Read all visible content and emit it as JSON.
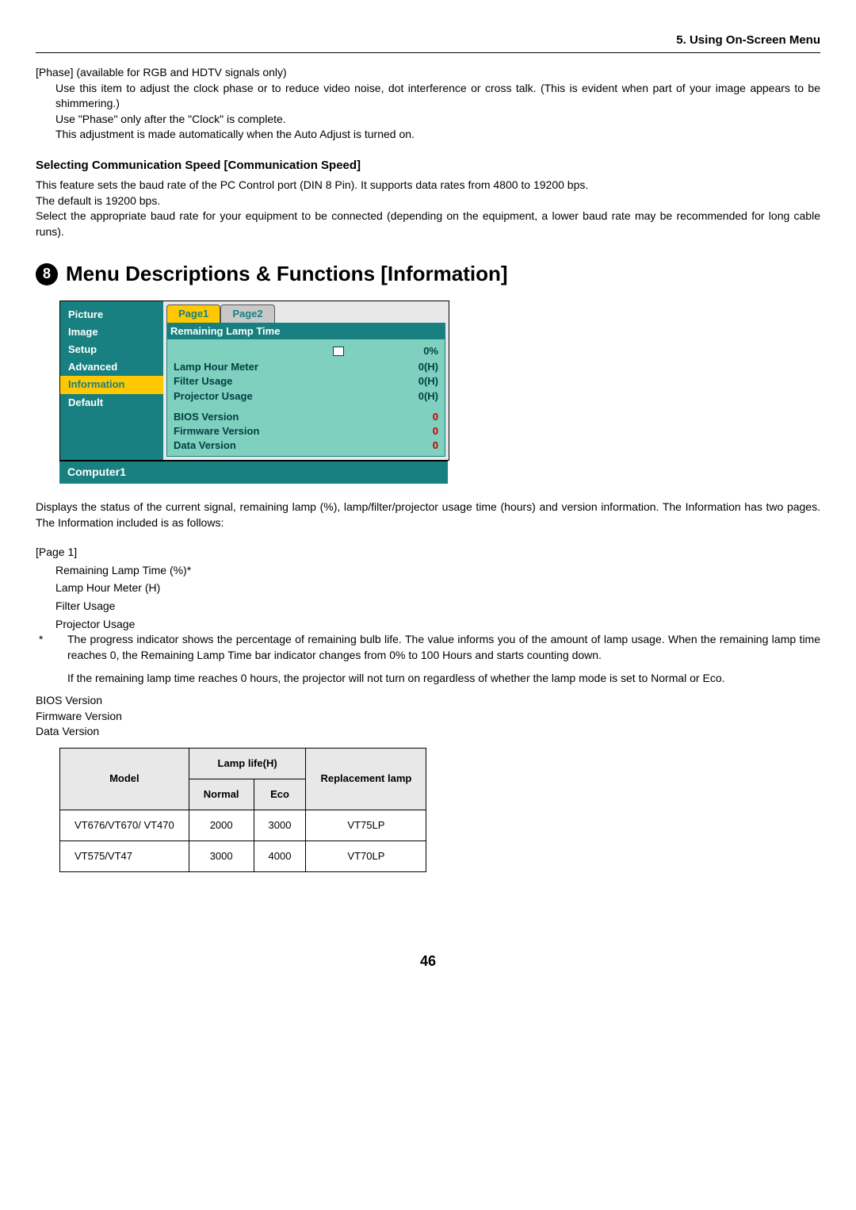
{
  "header": {
    "section": "5. Using On-Screen Menu"
  },
  "phase": {
    "title": "[Phase] (available for RGB and HDTV signals only)",
    "line1": "Use this item to adjust the clock phase or to reduce video noise, dot interference or cross talk. (This is evident when part of your image appears to be shimmering.)",
    "line2": "Use \"Phase\" only after the \"Clock\" is complete.",
    "line3": "This adjustment is made automatically when the Auto Adjust is turned on."
  },
  "comm": {
    "heading": "Selecting Communication Speed [Communication Speed]",
    "p1": "This feature sets the baud rate of the PC Control port (DIN 8 Pin). It supports data rates from 4800 to 19200 bps.",
    "p2": "The default is 19200 bps.",
    "p3": "Select the appropriate baud rate for your equipment to be connected (depending on the equipment, a lower baud rate may be recommended for long cable runs)."
  },
  "bigHeading": {
    "num": "8",
    "text": "Menu Descriptions & Functions [Information]"
  },
  "menuLeft": {
    "items": [
      "Picture",
      "Image",
      "Setup",
      "Advanced",
      "Information",
      "Default"
    ],
    "selected": "Information"
  },
  "tabs": {
    "page1": "Page1",
    "page2": "Page2"
  },
  "infoPage": {
    "header": "Remaining Lamp Time",
    "pct": "0%",
    "rows": [
      {
        "label": "Lamp Hour Meter",
        "val": "0(H)"
      },
      {
        "label": "Filter Usage",
        "val": "0(H)"
      },
      {
        "label": "Projector Usage",
        "val": "0(H)"
      }
    ],
    "versions": [
      {
        "label": "BIOS Version",
        "val": "0"
      },
      {
        "label": "Firmware Version",
        "val": "0"
      },
      {
        "label": "Data Version",
        "val": "0"
      }
    ]
  },
  "computerBar": "Computer1",
  "desc": {
    "p1": "Displays the status of the current signal, remaining lamp (%), lamp/filter/projector usage time (hours) and version information. The Information has two pages. The Information included is as follows:"
  },
  "page1": {
    "label": "[Page 1]",
    "i1": "Remaining Lamp Time (%)*",
    "i2": "Lamp Hour Meter (H)",
    "i3": "Filter Usage",
    "i4": "Projector Usage",
    "star": "The progress indicator shows the percentage of remaining bulb life. The value informs you of the amount of lamp usage. When the remaining lamp time reaches 0, the Remaining Lamp Time bar indicator changes from 0% to 100 Hours and starts counting down.",
    "note": "If the remaining lamp time reaches 0 hours, the projector will not turn on regardless of whether the lamp mode is set to Normal or Eco.",
    "v1": "BIOS Version",
    "v2": "Firmware Version",
    "v3": "Data Version"
  },
  "table": {
    "h_model": "Model",
    "h_lamp": "Lamp life(H)",
    "h_repl": "Replacement lamp",
    "h_normal": "Normal",
    "h_eco": "Eco",
    "r1": {
      "model": "VT676/VT670/ VT470",
      "normal": "2000",
      "eco": "3000",
      "repl": "VT75LP"
    },
    "r2": {
      "model": "VT575/VT47",
      "normal": "3000",
      "eco": "4000",
      "repl": "VT70LP"
    }
  },
  "pageNum": "46"
}
